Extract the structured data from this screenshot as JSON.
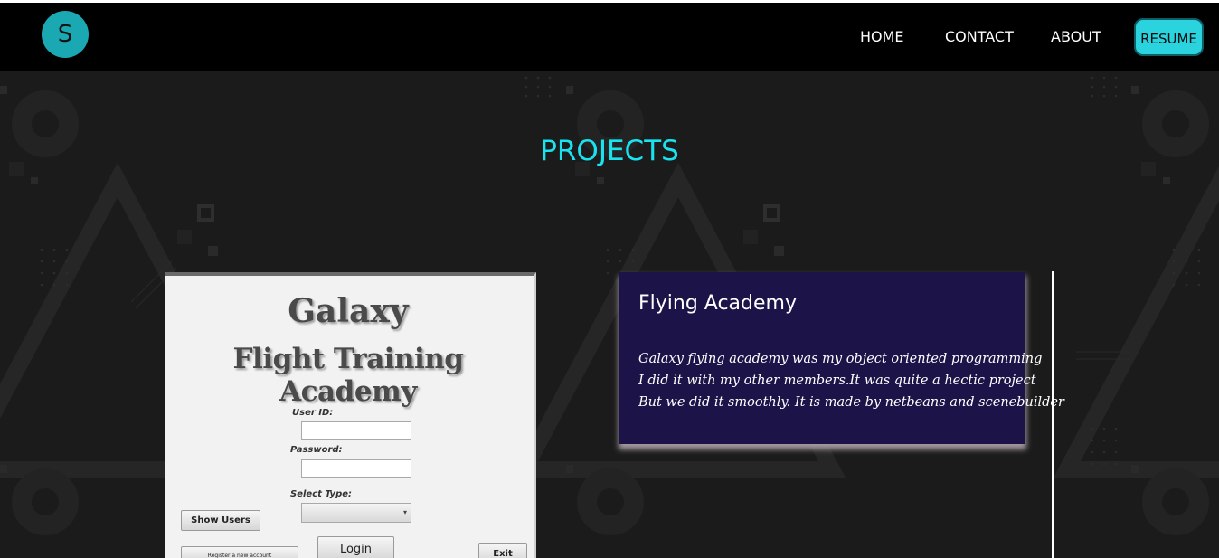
{
  "navbar": {
    "logo_letter": "S",
    "links": [
      "HOME",
      "CONTACT",
      "ABOUT"
    ],
    "resume_label": "RESUME"
  },
  "section": {
    "title": "PROJECTS"
  },
  "project": {
    "screenshot": {
      "title_line1": "Galaxy",
      "title_line2": "Flight Training Academy",
      "user_id_label": "User ID:",
      "password_label": "Password:",
      "select_type_label": "Select Type:",
      "show_users_label": "Show Users",
      "login_label": "Login",
      "register_label": "Register a new account",
      "exit_label": "Exit"
    },
    "card": {
      "title": "Flying Academy",
      "lines": [
        "Galaxy flying academy was my object oriented programming",
        "I did it with my other members.It was quite a hectic project",
        "But we did it smoothly. It is made by netbeans and scenebuilder"
      ]
    }
  },
  "colors": {
    "accent": "#19e3ef",
    "resume_bg": "#2ad3dd",
    "card_bg": "#1c1448",
    "navbar_bg": "#000000",
    "page_bg": "#1b1b1b"
  }
}
